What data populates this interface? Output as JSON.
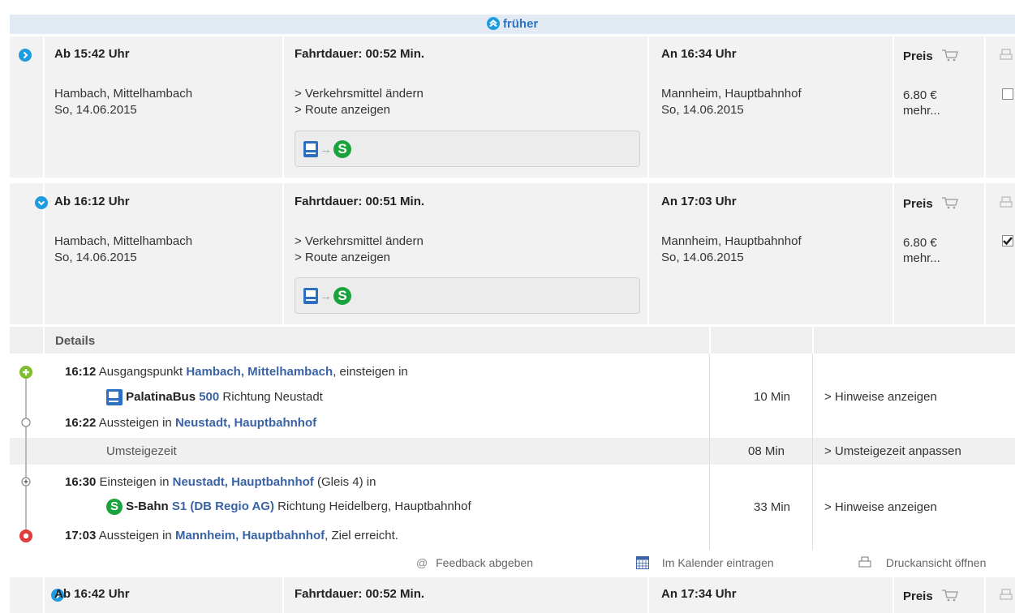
{
  "earlier": {
    "label": "früher"
  },
  "connections": [
    {
      "dep": "Ab 15:42 Uhr",
      "dep_station": "Hambach, Mittelhambach",
      "dep_date": "So, 14.06.2015",
      "duration": "Fahrtdauer: 00:52 Min.",
      "change_modes": "> Verkehrsmittel ändern",
      "show_route": "> Route anzeigen",
      "arr": "An 16:34 Uhr",
      "arr_station": "Mannheim, Hauptbahnhof",
      "arr_date": "So, 14.06.2015",
      "price_label": "Preis",
      "price": "6.80 €",
      "more": "mehr..."
    },
    {
      "dep": "Ab 16:12 Uhr",
      "dep_station": "Hambach, Mittelhambach",
      "dep_date": "So, 14.06.2015",
      "duration": "Fahrtdauer: 00:51 Min.",
      "change_modes": "> Verkehrsmittel ändern",
      "show_route": "> Route anzeigen",
      "arr": "An 17:03 Uhr",
      "arr_station": "Mannheim, Hauptbahnhof",
      "arr_date": "So, 14.06.2015",
      "price_label": "Preis",
      "price": "6.80 €",
      "more": "mehr..."
    },
    {
      "dep": "Ab 16:42 Uhr",
      "duration": "Fahrtdauer: 00:52 Min.",
      "arr": "An 17:34 Uhr",
      "price_label": "Preis"
    }
  ],
  "details": {
    "header": "Details",
    "leg1": {
      "time": "16:12",
      "text_a": "Ausgangspunkt",
      "station": "Hambach, Mittelhambach",
      "text_b": ", einsteigen in",
      "line_name": "PalatinaBus",
      "line_no": "500",
      "direction": "Richtung Neustadt",
      "duration": "10 Min",
      "hint": "> Hinweise anzeigen",
      "exit_time": "16:22",
      "exit_text": "Aussteigen in",
      "exit_station": "Neustadt, Hauptbahnhof"
    },
    "transfer": {
      "label": "Umsteigezeit",
      "duration": "08 Min",
      "link": "> Umsteigezeit anpassen"
    },
    "leg2": {
      "time": "16:30",
      "text_a": "Einsteigen in",
      "station": "Neustadt, Hauptbahnhof",
      "text_b": "(Gleis 4) in",
      "line_name": "S-Bahn",
      "line_no": "S1 (DB Regio AG)",
      "direction": "Richtung Heidelberg, Hauptbahnhof",
      "duration": "33 Min",
      "hint": "> Hinweise anzeigen",
      "exit_time": "17:03",
      "exit_text": "Aussteigen in",
      "exit_station": "Mannheim, Hauptbahnhof",
      "exit_suffix": ", Ziel erreicht."
    },
    "actions": {
      "feedback": "Feedback abgeben",
      "calendar": "Im Kalender eintragen",
      "print": "Druckansicht öffnen"
    }
  },
  "colors": {
    "accent_blue": "#1f9be0",
    "link": "#4a6d9e",
    "sbahn_green": "#1aa33d",
    "bus_blue": "#2d6fc0",
    "start_green": "#7cbf2a",
    "end_red": "#e03a3a"
  }
}
